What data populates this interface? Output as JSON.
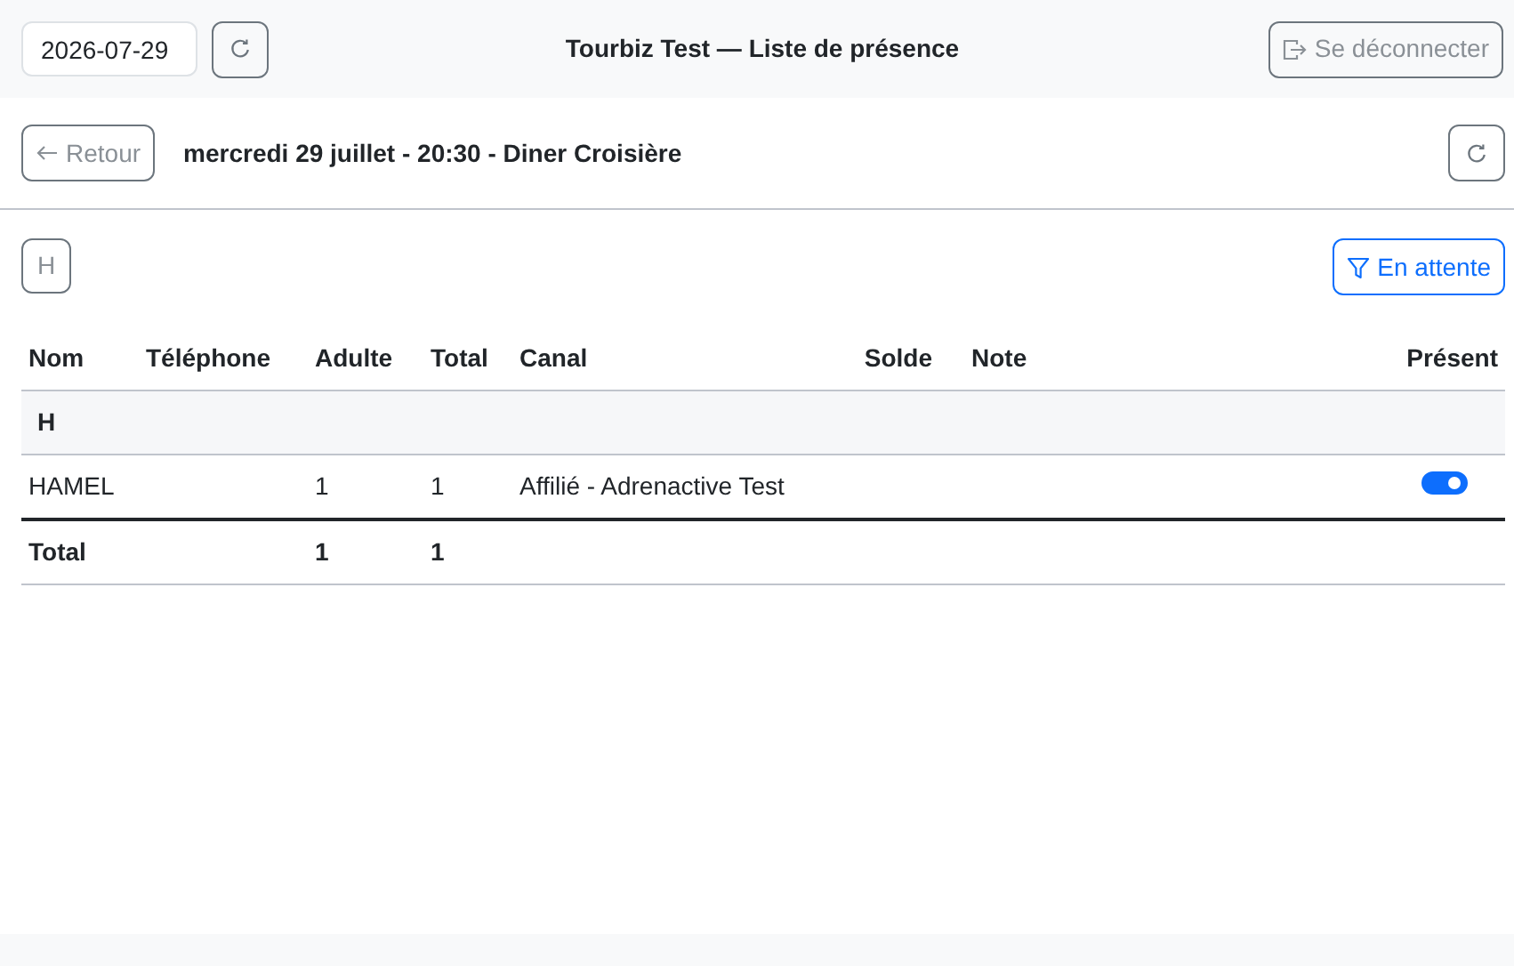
{
  "header": {
    "date": "2026-07-29",
    "title": "Tourbiz Test — Liste de présence",
    "logout": "Se déconnecter"
  },
  "event": {
    "back": "Retour",
    "title": "mercredi 29 juillet - 20:30 - Diner Croisière"
  },
  "letters": [
    "H"
  ],
  "filter": "En attente",
  "table": {
    "columns": [
      "Nom",
      "Téléphone",
      "Adulte",
      "Total",
      "Canal",
      "Solde",
      "Note",
      "Présent"
    ],
    "groups": [
      {
        "letter": "H",
        "rows": [
          {
            "nom": "HAMEL",
            "adulte": "1",
            "total": "1",
            "canal": "Affilié - Adrenactive Test",
            "present": true
          }
        ]
      }
    ],
    "footer": {
      "label": "Total",
      "adulte": "1",
      "total": "1"
    }
  }
}
